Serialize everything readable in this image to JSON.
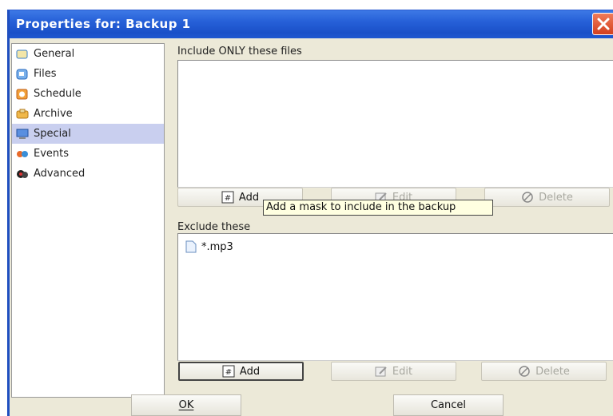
{
  "window": {
    "title": "Properties for: Backup 1"
  },
  "sidebar": {
    "items": [
      {
        "label": "General",
        "icon": "general-icon"
      },
      {
        "label": "Files",
        "icon": "files-icon"
      },
      {
        "label": "Schedule",
        "icon": "schedule-icon"
      },
      {
        "label": "Archive",
        "icon": "archive-icon"
      },
      {
        "label": "Special",
        "icon": "special-icon",
        "selected": true
      },
      {
        "label": "Events",
        "icon": "events-icon"
      },
      {
        "label": "Advanced",
        "icon": "advanced-icon"
      }
    ]
  },
  "include": {
    "label": "Include ONLY these files",
    "items": [],
    "buttons": {
      "add": "Add",
      "edit": "Edit",
      "delete": "Delete"
    }
  },
  "exclude": {
    "label": "Exclude these",
    "items": [
      "*.mp3"
    ],
    "buttons": {
      "add": "Add",
      "edit": "Edit",
      "delete": "Delete"
    }
  },
  "tooltip": "Add a mask to include in the backup",
  "footer": {
    "ok": "OK",
    "cancel": "Cancel"
  },
  "colors": {
    "titlebar": "#2660d8",
    "selection": "#c9cfef",
    "tooltip_bg": "#ffffe1",
    "close": "#d3401e"
  }
}
